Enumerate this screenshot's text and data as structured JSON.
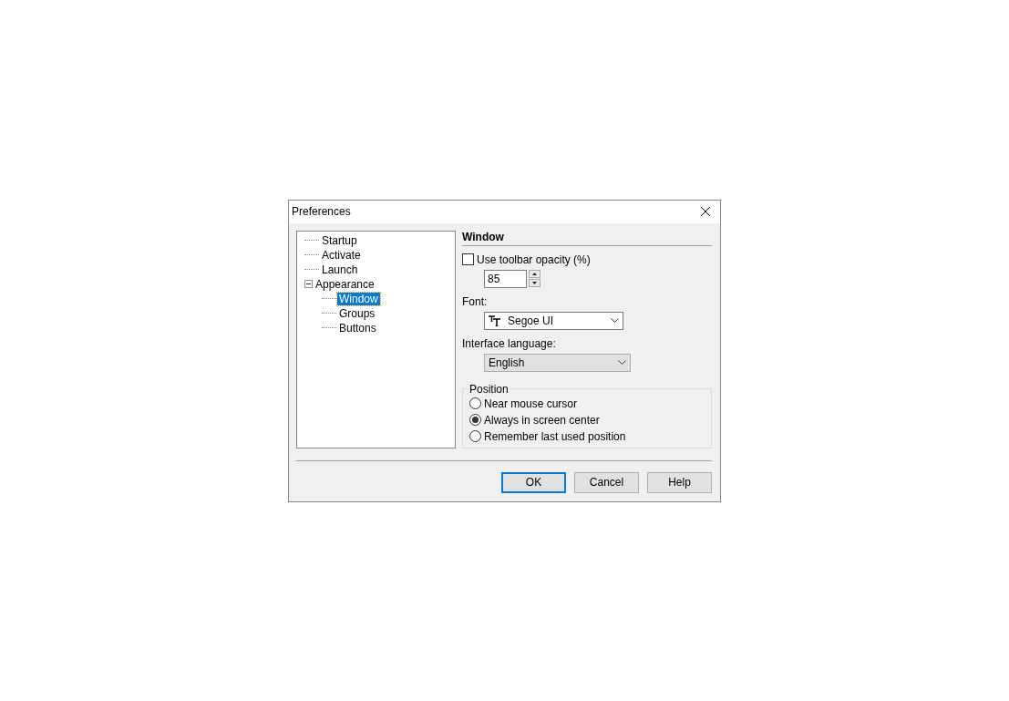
{
  "window": {
    "title": "Preferences"
  },
  "tree": [
    {
      "label": "Startup",
      "selected": false
    },
    {
      "label": "Activate",
      "selected": false
    },
    {
      "label": "Launch",
      "selected": false
    },
    {
      "label": "Appearance",
      "selected": false,
      "expanded": true,
      "children": [
        {
          "label": "Window",
          "selected": true
        },
        {
          "label": "Groups",
          "selected": false
        },
        {
          "label": "Buttons",
          "selected": false
        }
      ]
    }
  ],
  "section": {
    "title": "Window",
    "opacity": {
      "label": "Use toolbar opacity (%)",
      "checked": false,
      "value": "85"
    },
    "font": {
      "label": "Font:",
      "value": "Segoe UI"
    },
    "language": {
      "label": "Interface language:",
      "value": "English"
    },
    "position": {
      "legend": "Position",
      "options": [
        {
          "label": "Near mouse cursor",
          "selected": false
        },
        {
          "label": "Always in screen center",
          "selected": true
        },
        {
          "label": "Remember last used position",
          "selected": false
        }
      ]
    }
  },
  "buttons": [
    {
      "label": "OK",
      "default": true
    },
    {
      "label": "Cancel",
      "default": false
    },
    {
      "label": "Help",
      "default": false
    }
  ]
}
